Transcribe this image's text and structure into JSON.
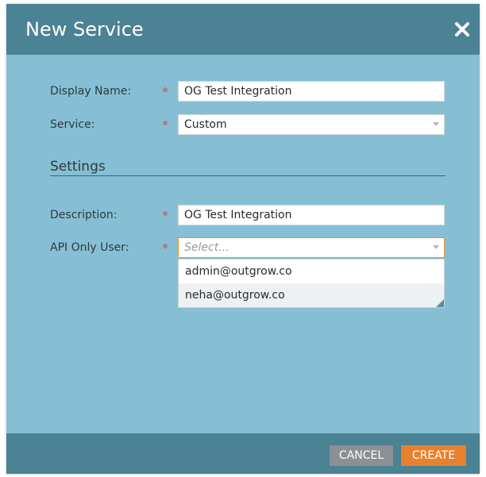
{
  "dialog": {
    "title": "New Service",
    "close_icon": "close-icon"
  },
  "form": {
    "display_name": {
      "label": "Display Name:",
      "required_mark": "*",
      "value": "OG Test Integration"
    },
    "service": {
      "label": "Service:",
      "required_mark": "*",
      "selected": "Custom"
    },
    "settings_heading": "Settings",
    "description": {
      "label": "Description:",
      "required_mark": "*",
      "value": "OG Test Integration"
    },
    "api_only_user": {
      "label": "API Only User:",
      "required_mark": "*",
      "placeholder": "Select...",
      "options": [
        "admin@outgrow.co",
        "neha@outgrow.co"
      ]
    }
  },
  "footer": {
    "cancel_label": "CANCEL",
    "create_label": "CREATE"
  },
  "colors": {
    "header": "#4b8294",
    "body": "#86bfd3",
    "required": "#c9534a",
    "create_button": "#e7812f",
    "cancel_button": "#8a9094",
    "focus_border": "#e59230"
  }
}
